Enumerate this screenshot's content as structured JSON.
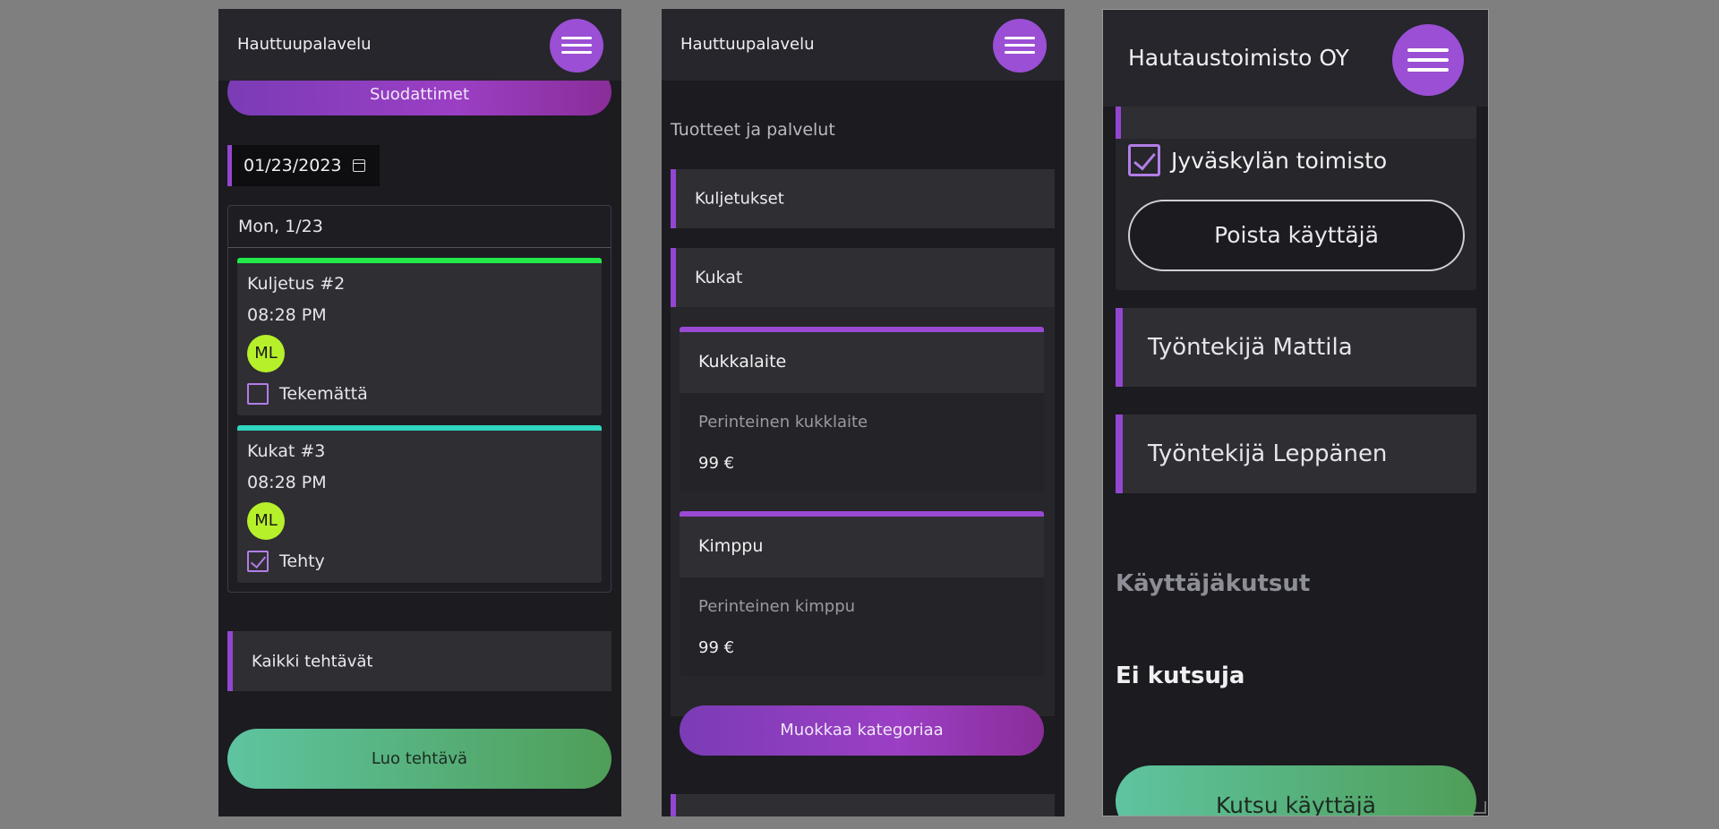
{
  "screens": {
    "tasks": {
      "app_title": "Hauttuupalavelu",
      "filters_label": "Suodattimet",
      "date_value": "01/23/2023",
      "day_label": "Mon, 1/23",
      "tasks": [
        {
          "title": "Kuljetus #2",
          "time": "08:28 PM",
          "initials": "ML",
          "status": "Tekemättä",
          "done": false,
          "bar_color": "#22e84a"
        },
        {
          "title": "Kukat #3",
          "time": "08:28 PM",
          "initials": "ML",
          "status": "Tehty",
          "done": true,
          "bar_color": "#2fd6c0"
        }
      ],
      "all_tasks_label": "Kaikki tehtävät",
      "create_task_label": "Luo tehtävä"
    },
    "products": {
      "app_title": "Hauttuupalavelu",
      "section_title": "Tuotteet ja palvelut",
      "categories": [
        {
          "label": "Kuljetukset"
        },
        {
          "label": "Kukat"
        }
      ],
      "products": [
        {
          "name": "Kukkalaite",
          "description": "Perinteinen kukklaite",
          "price": "99 €"
        },
        {
          "name": "Kimppu",
          "description": "Perinteinen kimppu",
          "price": "99 €"
        }
      ],
      "edit_category_label": "Muokkaa kategoriaa"
    },
    "users": {
      "app_title": "Hautaustoimisto OY",
      "office_label": "Jyväskylän toimisto",
      "office_checked": true,
      "remove_user_label": "Poista käyttäjä",
      "employees": [
        {
          "label": "Työntekijä Mattila"
        },
        {
          "label": "Työntekijä Leppänen"
        }
      ],
      "invites_heading": "Käyttäjäkutsut",
      "no_invites": "Ei kutsuja",
      "invite_user_label": "Kutsu käyttäjä"
    }
  },
  "colors": {
    "accent": "#9246d1",
    "menu_button": "#9b4fd4",
    "avatar": "#b6f02a",
    "background": "#1b1b20",
    "card": "#2e2e33"
  },
  "icons": {
    "menu": "hamburger-icon",
    "calendar": "calendar-icon",
    "checkbox": "checkbox-icon"
  }
}
